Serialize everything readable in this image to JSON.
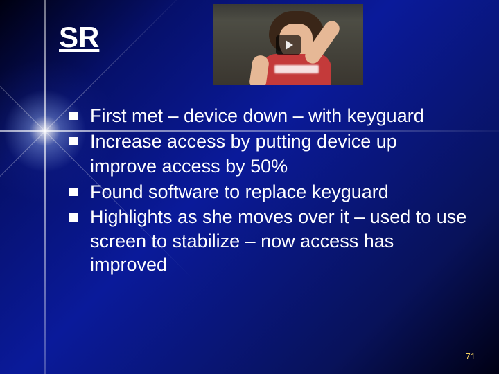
{
  "title": "SR",
  "video": {
    "play_label": "play"
  },
  "bullets": [
    {
      "text": "First met – device down – with keyguard"
    },
    {
      "text": "Increase access by putting device up",
      "continuation": "improve access by 50%"
    },
    {
      "text": "Found software to replace keyguard"
    },
    {
      "text": "Highlights as she moves over it – used to use screen to stabilize – now access has improved"
    }
  ],
  "page_number": "71"
}
